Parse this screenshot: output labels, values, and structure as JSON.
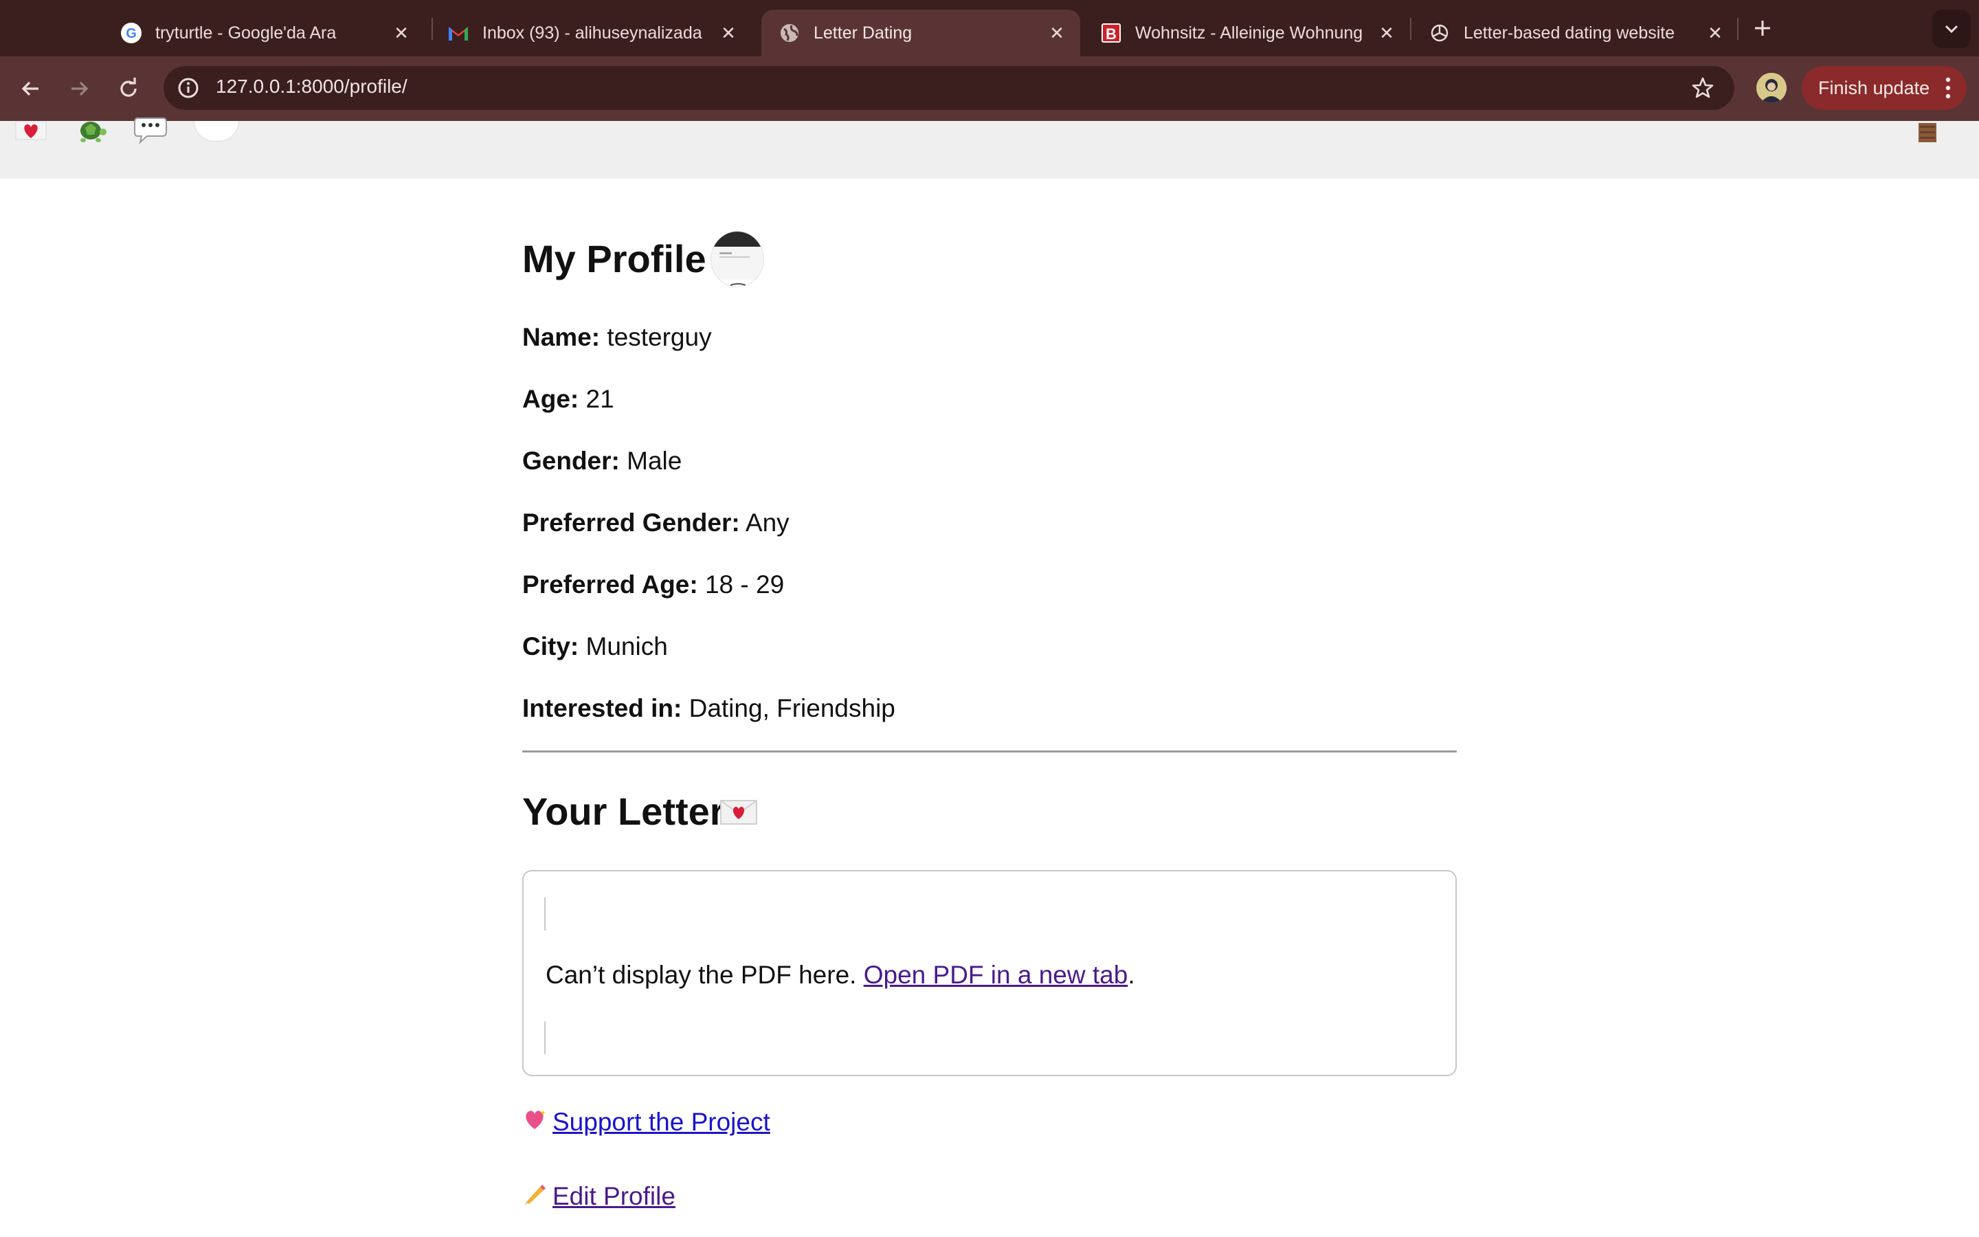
{
  "browser": {
    "tabs": [
      {
        "title": "tryturtle - Google'da Ara",
        "icon": "google-icon",
        "active": false
      },
      {
        "title": "Inbox (93) - alihuseynalizada",
        "icon": "gmail-icon",
        "active": false
      },
      {
        "title": "Letter Dating",
        "icon": "globe-icon",
        "active": true
      },
      {
        "title": "Wohnsitz - Alleinige Wohnung",
        "icon": "b-icon",
        "active": false
      },
      {
        "title": "Letter-based dating website",
        "icon": "chatgpt-icon",
        "active": false
      }
    ],
    "url": "127.0.0.1:8000/profile/",
    "update_label": "Finish update"
  },
  "site_nav": {
    "icons": [
      "heart-envelope-icon",
      "turtle-icon",
      "chat-bubble-icon",
      "profile-picture",
      "door-icon"
    ]
  },
  "profile": {
    "heading": "My Profile",
    "fields": [
      {
        "label": "Name:",
        "value": "testerguy"
      },
      {
        "label": "Age:",
        "value": "21"
      },
      {
        "label": "Gender:",
        "value": "Male"
      },
      {
        "label": "Preferred Gender:",
        "value": "Any"
      },
      {
        "label": "Preferred Age:",
        "value": "18 - 29"
      },
      {
        "label": "City:",
        "value": "Munich"
      },
      {
        "label": "Interested in:",
        "value": "Dating, Friendship"
      }
    ]
  },
  "letter": {
    "heading": "Your Letter",
    "pdf_message": "Can’t display the PDF here.",
    "pdf_link": "Open PDF in a new tab",
    "pdf_suffix": "."
  },
  "links": {
    "support": "Support the Project",
    "edit": "Edit Profile"
  },
  "colors": {
    "tabstrip": "#3b1f1f",
    "toolbar": "#5a3434",
    "update_button": "#8a2a2a",
    "link_blue": "#1a14cc",
    "link_visited": "#4a1a8c"
  }
}
